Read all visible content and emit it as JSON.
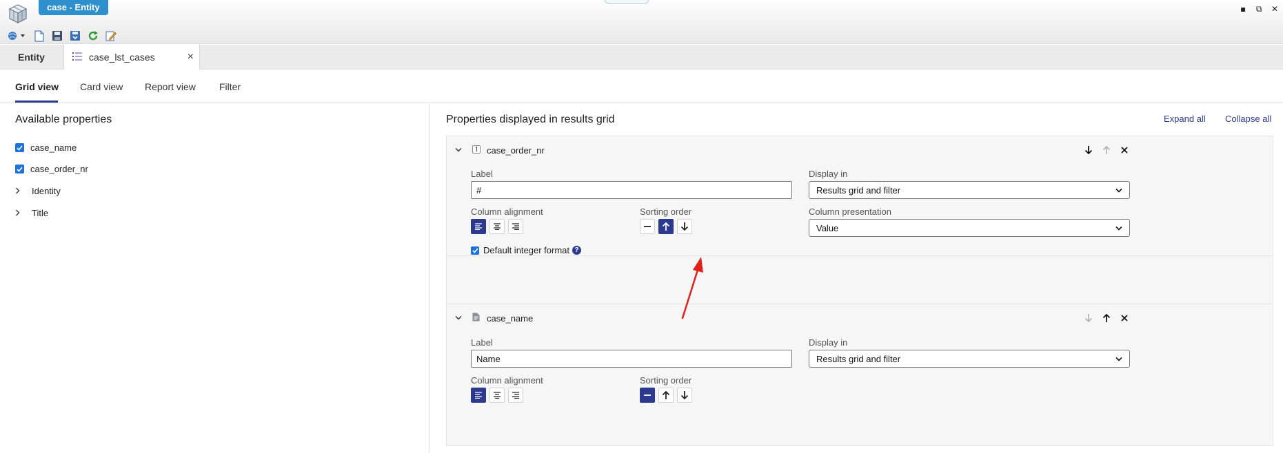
{
  "window": {
    "title": "case - Entity",
    "minimize": "▪",
    "restore": "⧉",
    "close": "✕"
  },
  "toolbar": {
    "icons": [
      "globe-dropdown-icon",
      "new-document-icon",
      "save-icon",
      "save-all-icon",
      "refresh-icon",
      "edit-icon"
    ]
  },
  "doc_tabs": [
    {
      "label": "Entity",
      "active": false
    },
    {
      "label": "case_lst_cases",
      "active": true,
      "icon": "list-icon",
      "close": "×"
    }
  ],
  "view_tabs": [
    "Grid view",
    "Card view",
    "Report view",
    "Filter"
  ],
  "left_pane": {
    "title": "Available properties",
    "items": [
      {
        "label": "case_name",
        "type": "checkbox",
        "checked": true
      },
      {
        "label": "case_order_nr",
        "type": "checkbox",
        "checked": true
      },
      {
        "label": "Identity",
        "type": "group"
      },
      {
        "label": "Title",
        "type": "group"
      }
    ]
  },
  "right_pane": {
    "title": "Properties displayed in results grid",
    "expand_all": "Expand all",
    "collapse_all": "Collapse all",
    "cards": [
      {
        "name": "case_order_nr",
        "type_icon": "integer-icon",
        "label_caption": "Label",
        "label_value": "#",
        "display_in_caption": "Display in",
        "display_in_value": "Results grid and filter",
        "column_alignment_caption": "Column alignment",
        "alignment_selected": "left",
        "sorting_order_caption": "Sorting order",
        "sorting_selected": "ascending",
        "column_presentation_caption": "Column presentation",
        "column_presentation_value": "Value",
        "default_format_label": "Default integer format",
        "default_format_checked": true,
        "help": "?"
      },
      {
        "name": "case_name",
        "type_icon": "text-document-icon",
        "label_caption": "Label",
        "label_value": "Name",
        "display_in_caption": "Display in",
        "display_in_value": "Results grid and filter",
        "column_alignment_caption": "Column alignment",
        "alignment_selected": "left",
        "sorting_order_caption": "Sorting order",
        "sorting_selected": "none"
      }
    ]
  },
  "colors": {
    "accent": "#2b3a8f",
    "title_tab": "#2d8fcb",
    "checkbox": "#1f72d8",
    "annotation_arrow": "#e0201b"
  }
}
